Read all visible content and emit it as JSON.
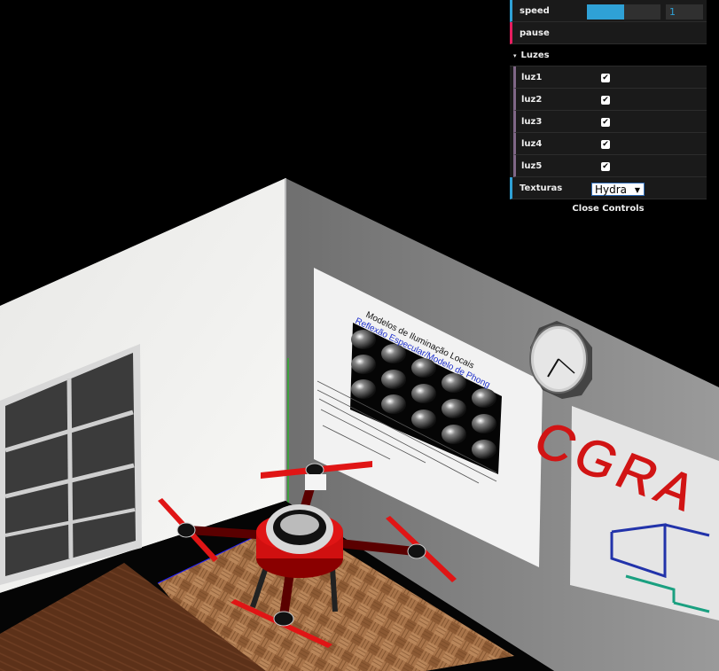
{
  "gui": {
    "speed": {
      "label": "speed",
      "value": "1",
      "fill": 0.5
    },
    "pause": {
      "label": "pause"
    },
    "folder": {
      "label": "Luzes",
      "arrow": "▾"
    },
    "lights": [
      {
        "label": "luz1",
        "checked": true,
        "mark": "✔"
      },
      {
        "label": "luz2",
        "checked": true,
        "mark": "✔"
      },
      {
        "label": "luz3",
        "checked": true,
        "mark": "✔"
      },
      {
        "label": "luz4",
        "checked": true,
        "mark": "✔"
      },
      {
        "label": "luz5",
        "checked": true,
        "mark": "✔"
      }
    ],
    "texturas": {
      "label": "Texturas",
      "selected": "Hydra",
      "arrow": "▼"
    },
    "close": "Close Controls"
  },
  "scene": {
    "board": {
      "title": "Modelos de Iluminação Locais",
      "subtitle": "Reflexão Especular/Modelo de Phong"
    },
    "wall_text": "CGRA",
    "colors": {
      "floor": "#9c6a3f",
      "wood": "#5c3119",
      "drone": "#d01010",
      "gui_bg": "#1a1a1a",
      "accent": "#2fa1d6"
    }
  }
}
